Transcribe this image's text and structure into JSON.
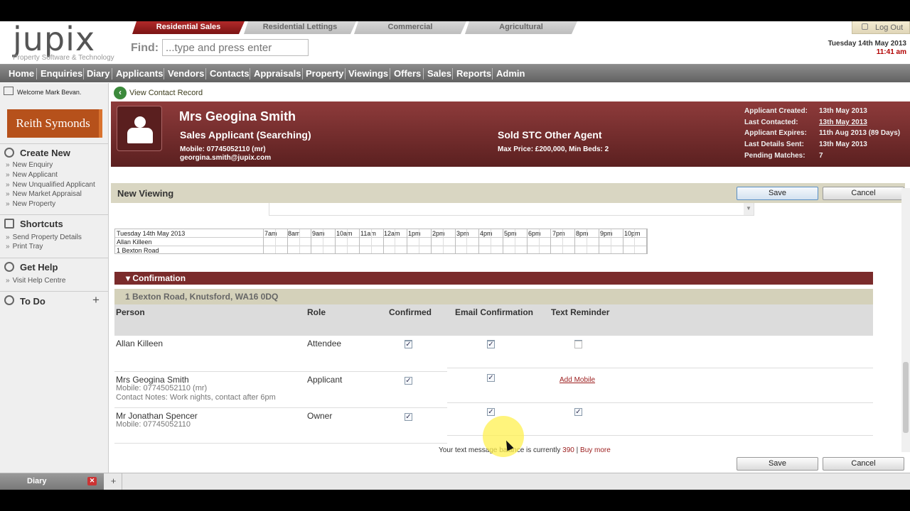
{
  "header": {
    "logo": "jupix",
    "logo_sub": "Property Software & Technology",
    "tabs": [
      "Residential Sales",
      "Residential Lettings",
      "Commercial",
      "Agricultural"
    ],
    "find_label": "Find:",
    "find_placeholder": "...type and press enter",
    "logout": "Log Out",
    "date": "Tuesday 14th May 2013",
    "time": "11:41 am"
  },
  "nav": [
    "Home",
    "Enquiries",
    "Diary",
    "Applicants",
    "Vendors",
    "Contacts",
    "Appraisals",
    "Property",
    "Viewings",
    "Offers",
    "Sales",
    "Reports",
    "Admin"
  ],
  "sidebar": {
    "welcome_prefix": "Welcome",
    "welcome_name": "Mark Bevan.",
    "brand": "Reith Symonds",
    "create_new": {
      "title": "Create New",
      "links": [
        "New Enquiry",
        "New Applicant",
        "New Unqualified Applicant",
        "New Market Appraisal",
        "New Property"
      ]
    },
    "shortcuts": {
      "title": "Shortcuts",
      "links": [
        "Send Property Details",
        "Print Tray"
      ]
    },
    "get_help": {
      "title": "Get Help",
      "links": [
        "Visit Help Centre"
      ]
    },
    "todo": {
      "title": "To Do",
      "plus": "+"
    }
  },
  "back_link": "View Contact Record",
  "contact": {
    "name": "Mrs Geogina Smith",
    "type": "Sales Applicant (Searching)",
    "mobile": "Mobile: 07745052110 (mr)",
    "email": "georgina.smith@jupix.com",
    "status": "Sold STC Other Agent",
    "criteria": "Max Price: £200,000, Min Beds: 2",
    "meta": [
      {
        "label": "Applicant Created:",
        "value": "13th May 2013"
      },
      {
        "label": "Last Contacted:",
        "value": "13th May 2013"
      },
      {
        "label": "Applicant Expires:",
        "value": "11th Aug 2013  (89 Days)"
      },
      {
        "label": "Last Details Sent:",
        "value": "13th May 2013"
      },
      {
        "label": "Pending Matches:",
        "value": "7"
      }
    ]
  },
  "viewing": {
    "title": "New Viewing",
    "save": "Save",
    "cancel": "Cancel"
  },
  "diary_grid": {
    "rows": [
      "Tuesday 14th May 2013",
      "Allan Killeen",
      "1 Bexton Road"
    ],
    "hours": [
      "7am",
      "8am",
      "9am",
      "10am",
      "11am",
      "12am",
      "1pm",
      "2pm",
      "3pm",
      "4pm",
      "5pm",
      "6pm",
      "7pm",
      "8pm",
      "9pm",
      "10pm"
    ]
  },
  "confirmation": {
    "title": "Confirmation",
    "address": "1 Bexton Road, Knutsford, WA16 0DQ",
    "columns": [
      "Person",
      "Role",
      "Confirmed",
      "Email Confirmation",
      "Text Reminder"
    ],
    "rows": [
      {
        "person": "Allan Killeen",
        "role": "Attendee",
        "sub1": "",
        "sub2": "",
        "confirmed": true,
        "email": true,
        "text": false,
        "add_mobile": ""
      },
      {
        "person": "Mrs Geogina Smith",
        "role": "Applicant",
        "sub1": "Mobile: 07745052110 (mr)",
        "sub2": "Contact Notes: Work nights, contact after 6pm",
        "confirmed": true,
        "email": true,
        "text": null,
        "add_mobile": "Add Mobile"
      },
      {
        "person": "Mr Jonathan Spencer",
        "role": "Owner",
        "sub1": "Mobile: 07745052110",
        "sub2": "",
        "confirmed": true,
        "email": true,
        "text": true,
        "add_mobile": ""
      }
    ],
    "balance_text": "Your text message balance is currently",
    "balance_value": "390",
    "buy_more": "Buy more"
  },
  "bottom": {
    "diary_tab": "Diary",
    "add_tab": "+"
  },
  "colors": {
    "brand_red": "#8e3b3b",
    "nav_grey": "#6e6e6e",
    "brand_orange": "#b6511b"
  }
}
